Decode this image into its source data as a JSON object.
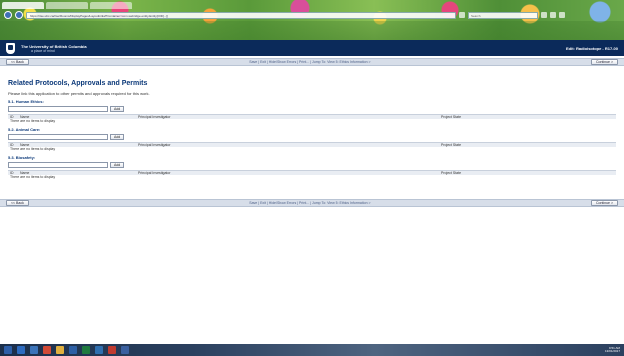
{
  "browser": {
    "address": "https://rise.ubc.ca/rise/Rooms/DisplayPages/LayoutInitial?Container=com.webridge.entity.Entity[OID[...]]",
    "search_placeholder": "Search",
    "tabs": [
      "",
      "",
      "",
      ""
    ]
  },
  "header": {
    "university_name": "The University of British Columbia",
    "tagline": "a place of mind",
    "edit_label": "Edit: Radioisotope - R17-00"
  },
  "nav": {
    "back_label": "<< Back",
    "links": "Save | Exit | Hide/Show Errors | Print... | Jump To: View 5: Ethics Information >",
    "continue_label": "Continue >"
  },
  "page": {
    "title": "Related Protocols, Approvals and Permits",
    "intro": "Please link this application to other permits and approvals required for this work."
  },
  "sections": [
    {
      "heading": "5.1. Human Ethics:",
      "add_label": "Add",
      "empty": "There are no items to display"
    },
    {
      "heading": "5.2. Animal Care:",
      "add_label": "Add",
      "empty": "There are no items to display"
    },
    {
      "heading": "5.3. Biosafety:",
      "add_label": "Add",
      "empty": "There are no items to display"
    }
  ],
  "table_columns": {
    "id": "ID",
    "name": "Name",
    "pi": "Principal Investigator",
    "state": "Project State"
  },
  "taskbar": {
    "time": "9:51 AM",
    "date": "13/01/2017",
    "icons": [
      "start-icon",
      "ie-icon",
      "explorer-icon",
      "chrome-icon",
      "folder-icon",
      "word-icon",
      "excel-icon",
      "outlook-icon",
      "media-icon",
      "app-icon"
    ],
    "icon_colors": [
      "#2e5fa8",
      "#2e6bbf",
      "#3b73b9",
      "#d24a36",
      "#e0b040",
      "#2d5fa5",
      "#1f7a3f",
      "#2f6fb0",
      "#c03a2f",
      "#3a5f9f"
    ]
  }
}
